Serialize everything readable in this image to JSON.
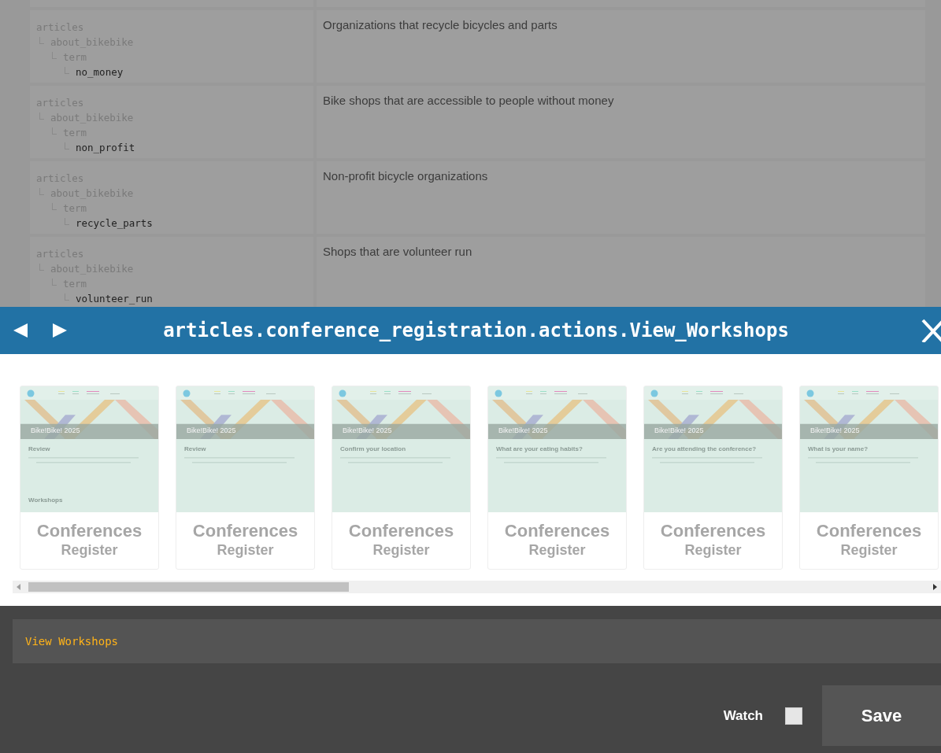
{
  "table": {
    "rows": [
      {
        "key_path": {
          "label": "articles",
          "children": [
            {
              "label": "about_bikebike",
              "children": [
                {
                  "label": "term",
                  "children": [
                    {
                      "label": "no_money"
                    }
                  ]
                }
              ]
            }
          ]
        },
        "description": "Organizations that recycle bicycles and parts"
      },
      {
        "key_path": {
          "label": "articles",
          "children": [
            {
              "label": "about_bikebike",
              "children": [
                {
                  "label": "term",
                  "children": [
                    {
                      "label": "non_profit"
                    }
                  ]
                }
              ]
            }
          ]
        },
        "description": "Bike shops that are accessible to people without money"
      },
      {
        "key_path": {
          "label": "articles",
          "children": [
            {
              "label": "about_bikebike",
              "children": [
                {
                  "label": "term",
                  "children": [
                    {
                      "label": "recycle_parts"
                    }
                  ]
                }
              ]
            }
          ]
        },
        "description": "Non-profit bicycle organizations"
      },
      {
        "key_path": {
          "label": "articles",
          "children": [
            {
              "label": "about_bikebike",
              "children": [
                {
                  "label": "term",
                  "children": [
                    {
                      "label": "volunteer_run"
                    }
                  ]
                }
              ]
            }
          ]
        },
        "description": "Shops that are volunteer run"
      }
    ]
  },
  "dialog": {
    "title": "articles.conference_registration.actions.View_Workshops",
    "cards": [
      {
        "thumbnail": {
          "banner_title": "Bike!Bike! 2025",
          "heading": "Review",
          "section": "Workshops"
        },
        "title": "Conferences",
        "subtitle": "Register"
      },
      {
        "thumbnail": {
          "banner_title": "Bike!Bike! 2025",
          "heading": "Review"
        },
        "title": "Conferences",
        "subtitle": "Register"
      },
      {
        "thumbnail": {
          "banner_title": "Bike!Bike! 2025",
          "heading": "Confirm your location"
        },
        "title": "Conferences",
        "subtitle": "Register"
      },
      {
        "thumbnail": {
          "banner_title": "Bike!Bike! 2025",
          "heading": "What are your eating habits?"
        },
        "title": "Conferences",
        "subtitle": "Register"
      },
      {
        "thumbnail": {
          "banner_title": "Bike!Bike! 2025",
          "heading": "Are you attending the conference?"
        },
        "title": "Conferences",
        "subtitle": "Register"
      },
      {
        "thumbnail": {
          "banner_title": "Bike!Bike! 2025",
          "heading": "What is your name?"
        },
        "title": "Conferences",
        "subtitle": "Register"
      }
    ]
  },
  "editor": {
    "value": "View Workshops",
    "watch": {
      "label": "Watch",
      "checked": false
    },
    "save_button": "Save"
  }
}
